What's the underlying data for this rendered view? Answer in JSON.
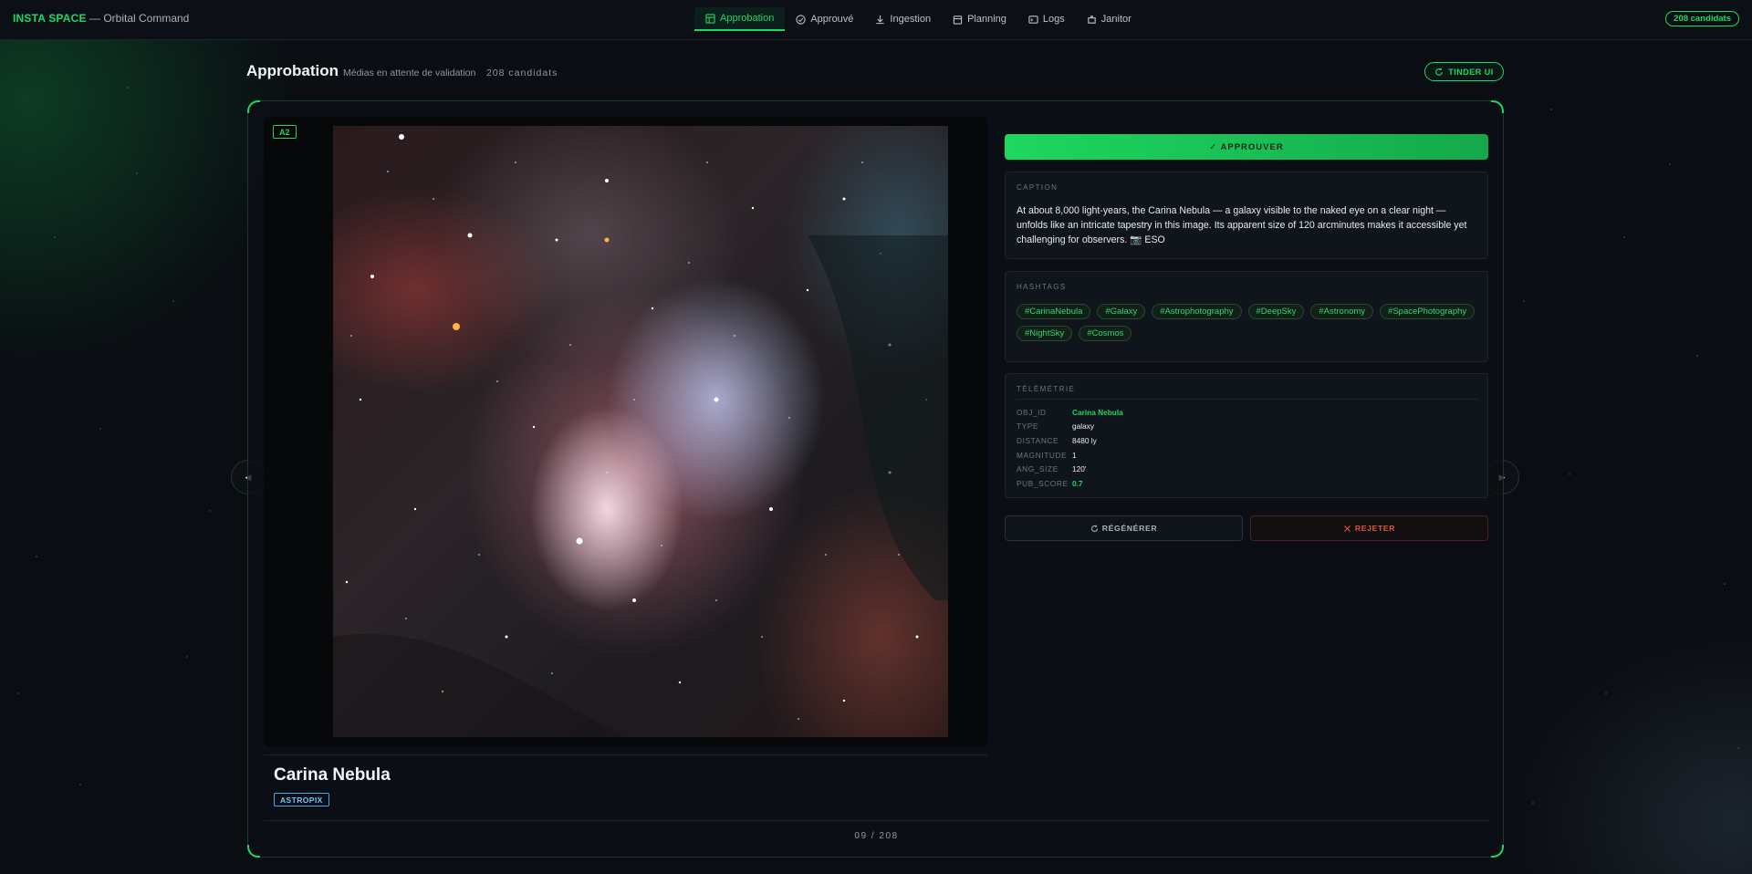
{
  "header": {
    "brand_strong": "INSTA SPACE",
    "brand_rest": " — Orbital Command",
    "nav": [
      {
        "label": "Approbation",
        "icon": "layout-icon",
        "active": true
      },
      {
        "label": "Approuvé",
        "icon": "check-circle-icon",
        "active": false
      },
      {
        "label": "Ingestion",
        "icon": "download-icon",
        "active": false
      },
      {
        "label": "Planning",
        "icon": "calendar-icon",
        "active": false
      },
      {
        "label": "Logs",
        "icon": "terminal-icon",
        "active": false
      },
      {
        "label": "Janitor",
        "icon": "broom-icon",
        "active": false
      }
    ],
    "candidates_pill": "208 candidats"
  },
  "page": {
    "title": "Approbation",
    "subtitle": "Médias en attente de validation",
    "count": "208 candidats",
    "tinder_button": "TINDER UI"
  },
  "media": {
    "badge": "A2",
    "title": "Carina Nebula",
    "source": "ASTROPIX",
    "pager": "09 / 208",
    "prev_arrow": "◀",
    "next_arrow": "▶"
  },
  "actions": {
    "approve": "✓ APPROUVER",
    "regenerate": "RÉGÉNÉRER",
    "reject": "REJETER"
  },
  "caption": {
    "label": "CAPTION",
    "text": "At about 8,000 light-years, the Carina Nebula — a galaxy visible to the naked eye on a clear night — unfolds like an intricate tapestry in this image. Its apparent size of 120 arcminutes makes it accessible yet challenging for observers. 📷 ESO"
  },
  "hashtags": {
    "label": "HASHTAGS",
    "items": [
      "#CarinaNebula",
      "#Galaxy",
      "#Astrophotography",
      "#DeepSky",
      "#Astronomy",
      "#SpacePhotography",
      "#NightSky",
      "#Cosmos"
    ]
  },
  "telemetry": {
    "label": "TÉLÉMÉTRIE",
    "rows": [
      {
        "key": "OBJ_ID",
        "value": "Carina Nebula"
      },
      {
        "key": "TYPE",
        "value": "galaxy"
      },
      {
        "key": "DISTANCE",
        "value": "8480 ly"
      },
      {
        "key": "MAGNITUDE",
        "value": "1"
      },
      {
        "key": "ANG_SIZE",
        "value": "120'"
      },
      {
        "key": "PUB_SCORE",
        "value": "0.7"
      }
    ]
  },
  "colors": {
    "accent": "#1ed760",
    "background": "#0a0d12",
    "reject": "#e0533f",
    "source_tag": "#4aa8e8"
  }
}
